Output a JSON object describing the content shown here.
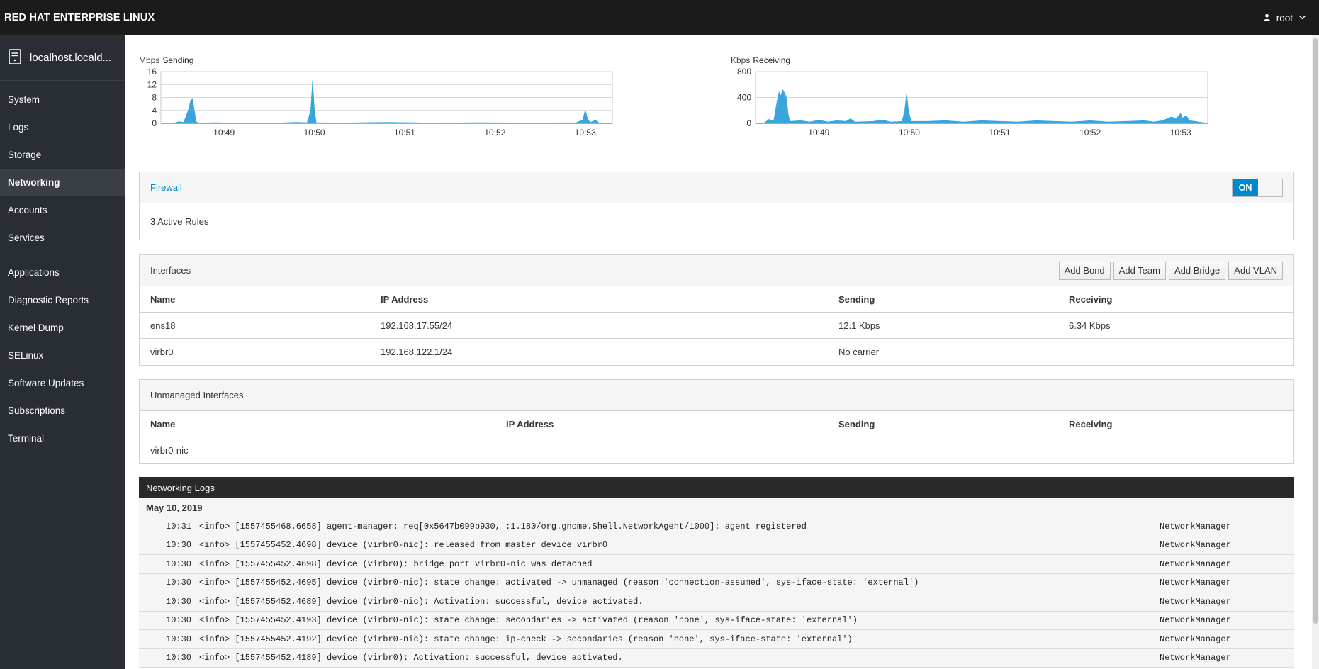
{
  "topbar": {
    "brand": "RED HAT ENTERPRISE LINUX",
    "user": "root",
    "user_icon": "user-icon",
    "chevron_icon": "chevron-down-icon"
  },
  "sidebar": {
    "host": "localhost.locald...",
    "host_icon": "server-icon",
    "group1": [
      {
        "label": "System",
        "active": false
      },
      {
        "label": "Logs",
        "active": false
      },
      {
        "label": "Storage",
        "active": false
      },
      {
        "label": "Networking",
        "active": true
      },
      {
        "label": "Accounts",
        "active": false
      },
      {
        "label": "Services",
        "active": false
      }
    ],
    "group2": [
      {
        "label": "Applications"
      },
      {
        "label": "Diagnostic Reports"
      },
      {
        "label": "Kernel Dump"
      },
      {
        "label": "SELinux"
      },
      {
        "label": "Software Updates"
      },
      {
        "label": "Subscriptions"
      },
      {
        "label": "Terminal"
      }
    ]
  },
  "chart_data": [
    {
      "type": "area",
      "title": "Sending",
      "ylabel": "Mbps",
      "ylim": [
        0,
        16
      ],
      "yticks": [
        0,
        4,
        8,
        12,
        16
      ],
      "xticks": [
        "10:49",
        "10:50",
        "10:51",
        "10:52",
        "10:53"
      ],
      "xrange_min": [
        0,
        5
      ],
      "xtick_pos_min": [
        0.7,
        1.7,
        2.7,
        3.7,
        4.7
      ],
      "color": "#39a5dc",
      "points": [
        [
          0,
          0
        ],
        [
          0.15,
          0.1
        ],
        [
          0.2,
          0.5
        ],
        [
          0.25,
          0.3
        ],
        [
          0.27,
          1.5
        ],
        [
          0.29,
          3
        ],
        [
          0.31,
          4.5
        ],
        [
          0.33,
          7
        ],
        [
          0.35,
          7.6
        ],
        [
          0.37,
          4
        ],
        [
          0.39,
          0.5
        ],
        [
          0.42,
          0.1
        ],
        [
          0.6,
          0.2
        ],
        [
          0.8,
          0.1
        ],
        [
          1.3,
          0.1
        ],
        [
          1.5,
          0.3
        ],
        [
          1.62,
          0.2
        ],
        [
          1.66,
          4
        ],
        [
          1.68,
          13
        ],
        [
          1.7,
          4
        ],
        [
          1.72,
          0.2
        ],
        [
          2.0,
          0.1
        ],
        [
          2.5,
          0.3
        ],
        [
          3.0,
          0.1
        ],
        [
          3.5,
          0.2
        ],
        [
          4.2,
          0.1
        ],
        [
          4.6,
          0.2
        ],
        [
          4.67,
          1
        ],
        [
          4.7,
          4
        ],
        [
          4.73,
          1
        ],
        [
          4.76,
          0.3
        ],
        [
          4.82,
          1
        ],
        [
          4.85,
          0.1
        ],
        [
          5,
          0
        ]
      ]
    },
    {
      "type": "area",
      "title": "Receiving",
      "ylabel": "Kbps",
      "ylim": [
        0,
        800
      ],
      "yticks": [
        0,
        400,
        800
      ],
      "xticks": [
        "10:49",
        "10:50",
        "10:51",
        "10:52",
        "10:53"
      ],
      "xrange_min": [
        0,
        5
      ],
      "xtick_pos_min": [
        0.7,
        1.7,
        2.7,
        3.7,
        4.7
      ],
      "color": "#39a5dc",
      "points": [
        [
          0,
          0
        ],
        [
          0.1,
          10
        ],
        [
          0.15,
          60
        ],
        [
          0.2,
          30
        ],
        [
          0.24,
          350
        ],
        [
          0.26,
          480
        ],
        [
          0.28,
          420
        ],
        [
          0.3,
          520
        ],
        [
          0.32,
          470
        ],
        [
          0.34,
          400
        ],
        [
          0.36,
          150
        ],
        [
          0.38,
          30
        ],
        [
          0.5,
          40
        ],
        [
          0.6,
          20
        ],
        [
          0.7,
          50
        ],
        [
          0.8,
          20
        ],
        [
          0.9,
          40
        ],
        [
          1.0,
          30
        ],
        [
          1.05,
          70
        ],
        [
          1.1,
          20
        ],
        [
          1.3,
          30
        ],
        [
          1.4,
          50
        ],
        [
          1.5,
          20
        ],
        [
          1.62,
          30
        ],
        [
          1.65,
          200
        ],
        [
          1.67,
          460
        ],
        [
          1.69,
          200
        ],
        [
          1.72,
          30
        ],
        [
          1.9,
          30
        ],
        [
          2.1,
          40
        ],
        [
          2.3,
          20
        ],
        [
          2.5,
          40
        ],
        [
          2.7,
          30
        ],
        [
          2.9,
          20
        ],
        [
          3.1,
          40
        ],
        [
          3.3,
          30
        ],
        [
          3.5,
          20
        ],
        [
          3.7,
          40
        ],
        [
          3.9,
          20
        ],
        [
          4.1,
          30
        ],
        [
          4.3,
          40
        ],
        [
          4.4,
          20
        ],
        [
          4.5,
          40
        ],
        [
          4.6,
          100
        ],
        [
          4.65,
          70
        ],
        [
          4.7,
          150
        ],
        [
          4.72,
          80
        ],
        [
          4.76,
          120
        ],
        [
          4.8,
          40
        ],
        [
          4.9,
          20
        ],
        [
          5,
          0
        ]
      ]
    }
  ],
  "firewall": {
    "link": "Firewall",
    "toggle_label": "ON",
    "rules": "3 Active Rules"
  },
  "interfaces": {
    "title": "Interfaces",
    "buttons": [
      "Add Bond",
      "Add Team",
      "Add Bridge",
      "Add VLAN"
    ],
    "columns": [
      "Name",
      "IP Address",
      "Sending",
      "Receiving"
    ],
    "rows": [
      {
        "name": "ens18",
        "ip": "192.168.17.55/24",
        "sending": "12.1 Kbps",
        "receiving": "6.34 Kbps"
      },
      {
        "name": "virbr0",
        "ip": "192.168.122.1/24",
        "sending": "No carrier",
        "receiving": ""
      }
    ]
  },
  "unmanaged": {
    "title": "Unmanaged Interfaces",
    "columns": [
      "Name",
      "IP Address",
      "Sending",
      "Receiving"
    ],
    "rows": [
      {
        "name": "virbr0-nic",
        "ip": "",
        "sending": "",
        "receiving": ""
      }
    ]
  },
  "logs": {
    "title": "Networking Logs",
    "date": "May 10, 2019",
    "entries": [
      {
        "time": "10:31",
        "msg": "<info> [1557455468.6658] agent-manager: req[0x5647b099b930, :1.180/org.gnome.Shell.NetworkAgent/1000]: agent registered",
        "src": "NetworkManager"
      },
      {
        "time": "10:30",
        "msg": "<info> [1557455452.4698] device (virbr0-nic): released from master device virbr0",
        "src": "NetworkManager"
      },
      {
        "time": "10:30",
        "msg": "<info> [1557455452.4698] device (virbr0): bridge port virbr0-nic was detached",
        "src": "NetworkManager"
      },
      {
        "time": "10:30",
        "msg": "<info> [1557455452.4695] device (virbr0-nic): state change: activated -> unmanaged (reason 'connection-assumed', sys-iface-state: 'external')",
        "src": "NetworkManager"
      },
      {
        "time": "10:30",
        "msg": "<info> [1557455452.4689] device (virbr0-nic): Activation: successful, device activated.",
        "src": "NetworkManager"
      },
      {
        "time": "10:30",
        "msg": "<info> [1557455452.4193] device (virbr0-nic): state change: secondaries -> activated (reason 'none', sys-iface-state: 'external')",
        "src": "NetworkManager"
      },
      {
        "time": "10:30",
        "msg": "<info> [1557455452.4192] device (virbr0-nic): state change: ip-check -> secondaries (reason 'none', sys-iface-state: 'external')",
        "src": "NetworkManager"
      },
      {
        "time": "10:30",
        "msg": "<info> [1557455452.4189] device (virbr0): Activation: successful, device activated.",
        "src": "NetworkManager"
      }
    ]
  }
}
